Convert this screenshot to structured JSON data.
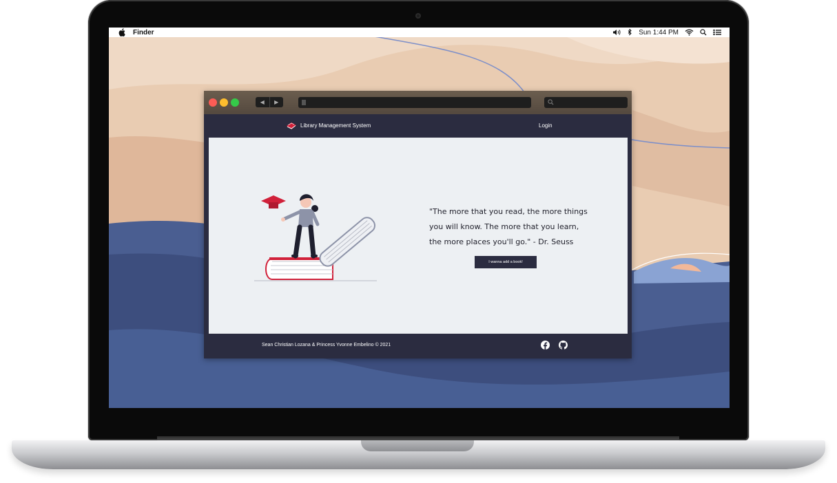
{
  "menubar": {
    "app_name": "Finder",
    "clock": "Sun 1:44 PM"
  },
  "site": {
    "brand": "Library Management System",
    "nav_login": "Login",
    "quote": "\"The more that you read, the more things you will know. The more that you learn, the more places you'll go.\" - Dr. Seuss",
    "cta_button": "I wanna add a book!",
    "footer_credits": "Sean Christian Lozana & Princess Yvonne Embelino © 2021"
  },
  "colors": {
    "navy": "#2b2c40",
    "accent_red": "#d1213a",
    "page_bg": "#edf0f3"
  },
  "icons": [
    "apple-icon",
    "volume-icon",
    "bluetooth-icon",
    "wifi-icon",
    "spotlight-icon",
    "control-center-icon",
    "back-icon",
    "forward-icon",
    "search-icon",
    "book-logo-icon",
    "facebook-icon",
    "github-icon"
  ]
}
